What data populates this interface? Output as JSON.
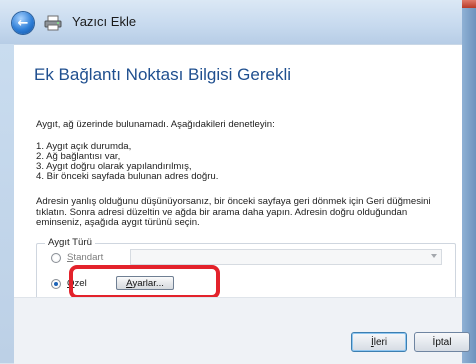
{
  "window": {
    "title": "Yazıcı Ekle"
  },
  "page": {
    "heading": "Ek Bağlantı Noktası Bilgisi Gerekli",
    "intro": "Aygıt, ağ üzerinde bulunamadı.  Aşağıdakileri denetleyin:",
    "checks": [
      "1.  Aygıt açık durumda,",
      "2.  Ağ bağlantısı var,",
      "3.  Aygıt doğru olarak yapılandırılmış,",
      "4.  Bir önceki sayfada bulunan adres doğru."
    ],
    "note_lines": [
      "Adresin yanlış olduğunu düşünüyorsanız, bir önceki sayfaya geri dönmek için Geri düğmesini",
      "tıklatın. Sonra adresi düzeltin ve ağda bir arama daha yapın. Adresin doğru olduğundan",
      "eminseniz, aşağıda aygıt türünü seçin."
    ]
  },
  "device_type": {
    "group_label": "Aygıt Türü",
    "standard": {
      "first": "S",
      "rest": "tandart",
      "checked": false,
      "enabled": false
    },
    "dropdown_value": "",
    "custom": {
      "first": "Ö",
      "rest": "zel",
      "checked": true
    },
    "settings_button": {
      "first": "A",
      "rest": "yarlar..."
    }
  },
  "footer": {
    "next": {
      "first": "İ",
      "rest": "leri"
    },
    "cancel": "İptal"
  },
  "colors": {
    "heading": "#1f4f8f",
    "highlight": "#e3222b",
    "accent": "#1d63b7"
  }
}
